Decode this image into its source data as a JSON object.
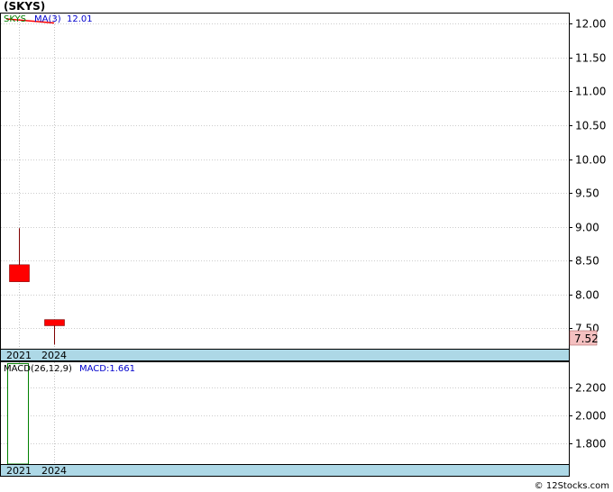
{
  "chart_data": [
    {
      "type": "candlestick",
      "title": "(SKYS)",
      "symbol_label": "SKYS",
      "ma_label": "MA(3)",
      "ma_value_label": "12.01",
      "x_ticks": [
        "2021",
        "2024"
      ],
      "y_ticks": [
        "12.00",
        "11.50",
        "11.00",
        "10.50",
        "10.00",
        "9.50",
        "9.00",
        "8.50",
        "8.00",
        "7.50"
      ],
      "ylim": [
        7.2,
        12.15
      ],
      "grid": true,
      "last_price_label": "7.52",
      "candles": [
        {
          "x": "2021",
          "open": 8.44,
          "close": 8.19,
          "high": 8.98,
          "low": 8.19
        },
        {
          "x": "2024",
          "open": 7.63,
          "close": 7.54,
          "high": 7.63,
          "low": 7.26
        }
      ],
      "ma_line": [
        {
          "x": "2021",
          "y": 12.07
        },
        {
          "x": "2024",
          "y": 12.01
        }
      ],
      "colors": {
        "candle": "#ff0000",
        "ma": "#ff0000",
        "symbol": "#008000",
        "ma_label": "#0000cc",
        "last_price_bg": "#f4c0c0",
        "axis_band": "#add8e6"
      }
    },
    {
      "type": "bar",
      "label": "MACD(26,12,9)",
      "value_label": "MACD:1.661",
      "x_ticks": [
        "2021",
        "2024"
      ],
      "y_ticks": [
        "2.200",
        "2.000",
        "1.800"
      ],
      "ylim": [
        1.65,
        2.38
      ],
      "grid": true,
      "bars": [
        {
          "x": "2021",
          "value": 2.37
        }
      ],
      "colors": {
        "bar": "#008000",
        "label": "#0000cc"
      }
    }
  ],
  "footer": {
    "copyright": "© 12Stocks.com"
  }
}
